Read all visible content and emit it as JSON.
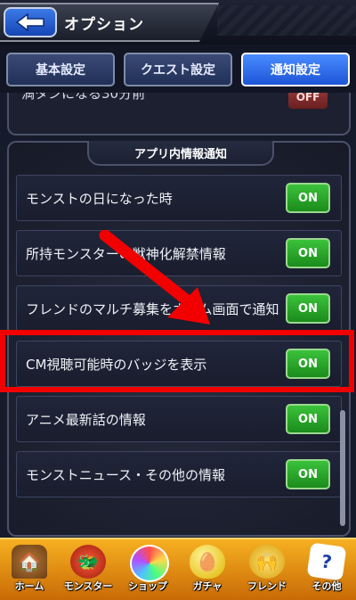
{
  "header": {
    "title": "オプション",
    "back_icon": "back-arrow-icon"
  },
  "tabs": [
    {
      "label": "基本設定",
      "active": false
    },
    {
      "label": "クエスト設定",
      "active": false
    },
    {
      "label": "通知設定",
      "active": true
    }
  ],
  "previous_section": {
    "partial_label": "満タンになる30分前",
    "toggle": "OFF"
  },
  "section": {
    "title": "アプリ内情報通知",
    "items": [
      {
        "label": "モンストの日になった時",
        "toggle": "ON"
      },
      {
        "label": "所持モンスターの獣神化解禁情報",
        "toggle": "ON"
      },
      {
        "label": "フレンドのマルチ募集をホーム画面で通知",
        "toggle": "ON"
      },
      {
        "label": "CM視聴可能時のバッジを表示",
        "toggle": "ON"
      },
      {
        "label": "アニメ最新話の情報",
        "toggle": "ON"
      },
      {
        "label": "モンストニュース・その他の情報",
        "toggle": "ON"
      }
    ]
  },
  "bottom_nav": [
    {
      "label": "ホーム",
      "icon": "home-icon"
    },
    {
      "label": "モンスター",
      "icon": "monster-icon"
    },
    {
      "label": "ショップ",
      "icon": "shop-orb-icon"
    },
    {
      "label": "ガチャ",
      "icon": "gacha-egg-icon"
    },
    {
      "label": "フレンド",
      "icon": "friend-hands-icon"
    },
    {
      "label": "その他",
      "icon": "other-question-icon"
    }
  ],
  "colors": {
    "highlight": "#f20000",
    "toggle_on": "#2aa62a",
    "nav_bg": "#e69010",
    "tab_active": "#2d6ef0"
  }
}
